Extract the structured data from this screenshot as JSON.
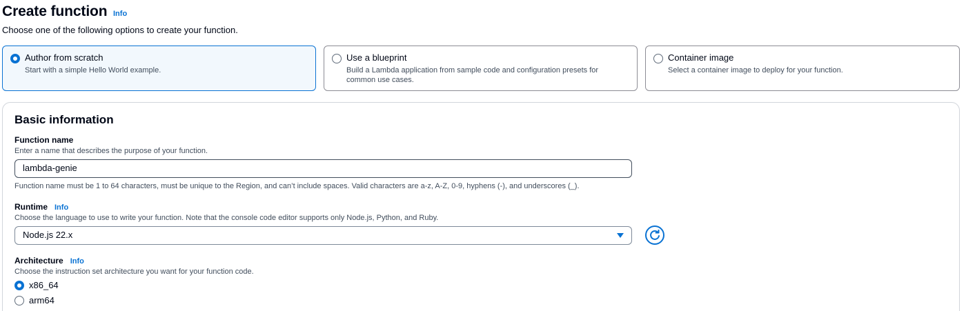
{
  "header": {
    "title": "Create function",
    "info_label": "Info",
    "subtitle": "Choose one of the following options to create your function."
  },
  "options": [
    {
      "title": "Author from scratch",
      "description": "Start with a simple Hello World example.",
      "selected": true
    },
    {
      "title": "Use a blueprint",
      "description": "Build a Lambda application from sample code and configuration presets for common use cases.",
      "selected": false
    },
    {
      "title": "Container image",
      "description": "Select a container image to deploy for your function.",
      "selected": false
    }
  ],
  "basic_info": {
    "title": "Basic information",
    "function_name": {
      "label": "Function name",
      "description": "Enter a name that describes the purpose of your function.",
      "value": "lambda-genie",
      "constraint": "Function name must be 1 to 64 characters, must be unique to the Region, and can’t include spaces. Valid characters are a-z, A-Z, 0-9, hyphens (-), and underscores (_)."
    },
    "runtime": {
      "label": "Runtime",
      "info_label": "Info",
      "description": "Choose the language to use to write your function. Note that the console code editor supports only Node.js, Python, and Ruby.",
      "value": "Node.js 22.x"
    },
    "architecture": {
      "label": "Architecture",
      "info_label": "Info",
      "description": "Choose the instruction set architecture you want for your function code.",
      "options": [
        {
          "label": "x86_64",
          "selected": true
        },
        {
          "label": "arm64",
          "selected": false
        }
      ]
    }
  },
  "colors": {
    "accent": "#0972d3",
    "selected_card_bg": "#f2f8fd",
    "text": "#000716",
    "secondary_text": "#414d5c"
  }
}
